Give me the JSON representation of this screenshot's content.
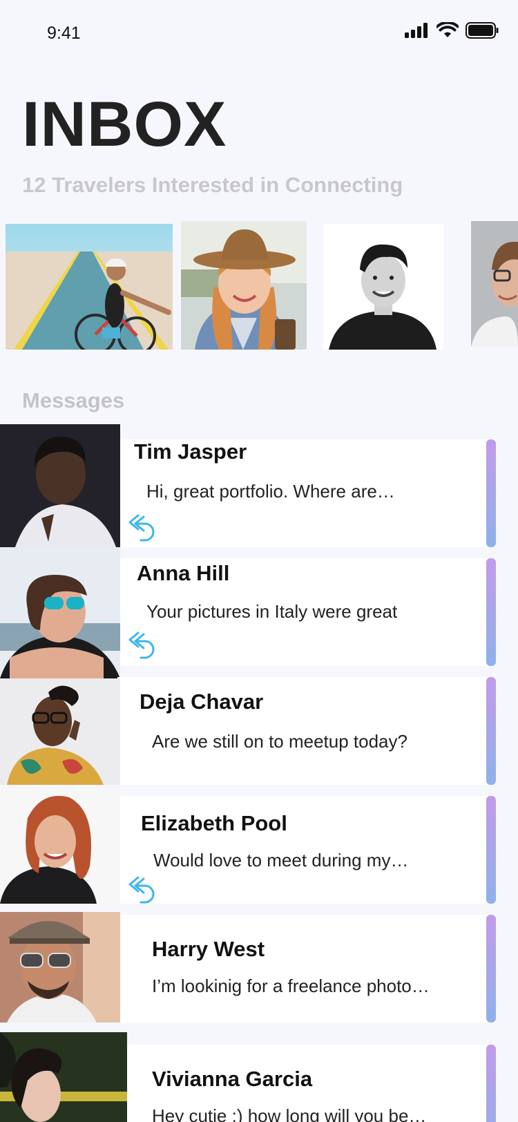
{
  "status_bar": {
    "time": "9:41",
    "icons": [
      "signal-icon",
      "wifi-icon",
      "battery-icon"
    ]
  },
  "header": {
    "title": "INBOX",
    "subtitle": "12 Travelers Interested in Connecting"
  },
  "travelers": [
    {
      "alt": "woman with bicycle on coastal road"
    },
    {
      "alt": "woman with hat and coffee"
    },
    {
      "alt": "smiling young man"
    },
    {
      "alt": "man with glasses"
    }
  ],
  "messages_section": {
    "label": "Messages"
  },
  "messages": [
    {
      "name": "Tim Jasper",
      "preview": "Hi, great portfolio. Where are…",
      "replied": true
    },
    {
      "name": "Anna Hill",
      "preview": "Your pictures in Italy were great",
      "replied": true
    },
    {
      "name": "Deja Chavar",
      "preview": "Are we still on to meetup today?",
      "replied": false
    },
    {
      "name": "Elizabeth Pool",
      "preview": "Would love to meet during my…",
      "replied": true
    },
    {
      "name": "Harry West",
      "preview": "I’m lookinig for a freelance photo…",
      "replied": false
    },
    {
      "name": "Vivianna Garcia",
      "preview": "Hey cutie :) how long will you be…",
      "replied": false
    }
  ],
  "colors": {
    "background": "#f6f7fc",
    "accent_top": "#c29be8",
    "accent_bottom": "#8fb1ea",
    "reply_icon": "#3bb6ef",
    "muted_text": "#c8c8cc"
  }
}
